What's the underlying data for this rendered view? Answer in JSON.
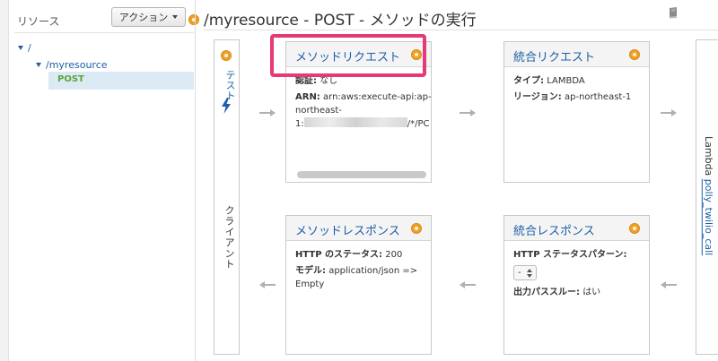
{
  "sidebar": {
    "resources_label": "リソース",
    "actions_label": "アクション",
    "tree": [
      {
        "label": "/"
      },
      {
        "label": "/myresource"
      },
      {
        "label": "POST"
      }
    ]
  },
  "header": {
    "title": "/myresource - POST - メソッドの実行"
  },
  "client": {
    "test_label": "テスト",
    "client_label": "クライアント"
  },
  "method_request": {
    "title": "メソッドリクエスト",
    "auth_key": "認証:",
    "auth_value": "なし",
    "arn_key": "ARN:",
    "arn_line1": "arn:aws:execute-api:ap-",
    "arn_line2": "northeast-",
    "arn_line3_prefix": "1:",
    "arn_line3_suffix": "/*/PC"
  },
  "integration_request": {
    "title": "統合リクエスト",
    "type_key": "タイプ:",
    "type_value": "LAMBDA",
    "region_key": "リージョン:",
    "region_value": "ap-northeast-1"
  },
  "method_response": {
    "title": "メソッドレスポンス",
    "status_key": "HTTP のステータス:",
    "status_value": "200",
    "model_key": "モデル:",
    "model_value_line1": "application/json =>",
    "model_value_line2": "Empty"
  },
  "integration_response": {
    "title": "統合レスポンス",
    "pattern_key": "HTTP ステータスパターン:",
    "pattern_value": "-",
    "passthrough_key": "出力パススルー:",
    "passthrough_value": "はい"
  },
  "lambda": {
    "prefix": "Lambda",
    "function_name": "polly_twilio_call"
  },
  "colors": {
    "link": "#1e5fa8",
    "highlight": "#e63a78",
    "badge": "#f0a12a",
    "post": "#5aa637"
  },
  "icons": [
    "orange-badge-icon",
    "book-icon",
    "lightning-icon",
    "arrow-right-icon",
    "arrow-left-icon"
  ]
}
